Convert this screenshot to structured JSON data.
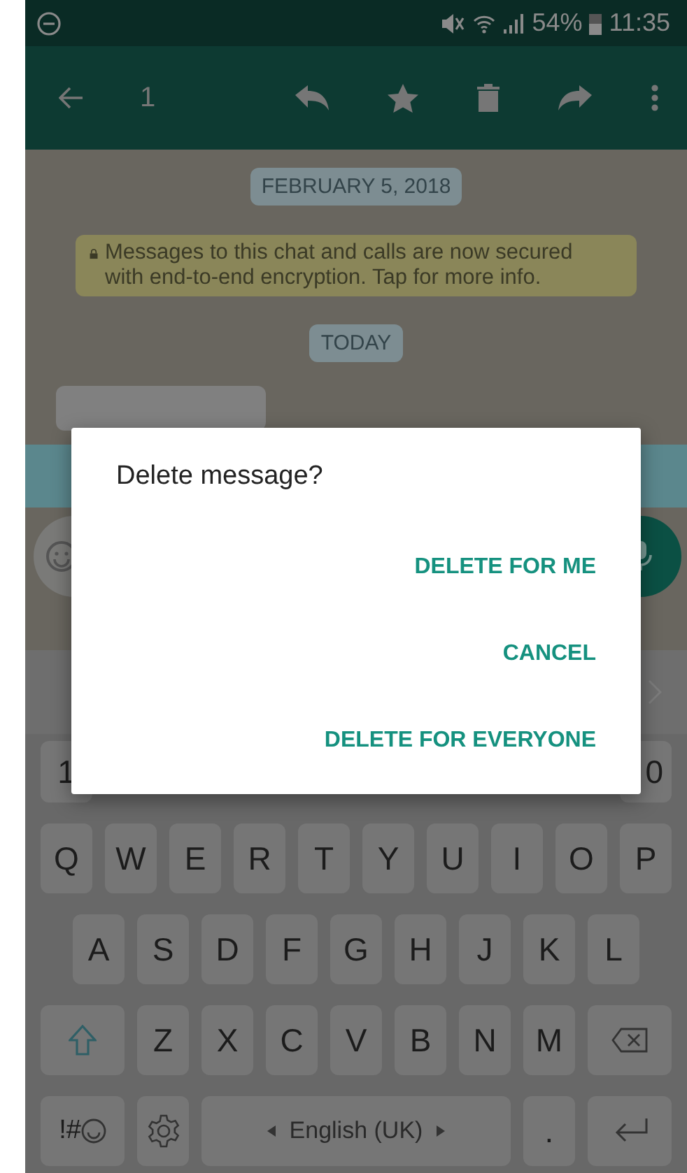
{
  "status_bar": {
    "battery": "54%",
    "time": "11:35"
  },
  "toolbar": {
    "selected_count": "1"
  },
  "chat": {
    "date_chip": "FEBRUARY 5, 2018",
    "encryption_notice": "Messages to this chat and calls are now secured with end-to-end encryption. Tap for more info.",
    "day_chip": "TODAY"
  },
  "keyboard": {
    "number_row": [
      "1",
      "0"
    ],
    "rows": [
      {
        "keys": [
          {
            "kind": "letter",
            "label": "Q"
          },
          {
            "kind": "letter",
            "label": "W"
          },
          {
            "kind": "letter",
            "label": "E"
          },
          {
            "kind": "letter",
            "label": "R"
          },
          {
            "kind": "letter",
            "label": "T"
          },
          {
            "kind": "letter",
            "label": "Y"
          },
          {
            "kind": "letter",
            "label": "U"
          },
          {
            "kind": "letter",
            "label": "I"
          },
          {
            "kind": "letter",
            "label": "O"
          },
          {
            "kind": "letter",
            "label": "P"
          }
        ]
      },
      {
        "keys": [
          {
            "kind": "letter",
            "label": "A"
          },
          {
            "kind": "letter",
            "label": "S"
          },
          {
            "kind": "letter",
            "label": "D"
          },
          {
            "kind": "letter",
            "label": "F"
          },
          {
            "kind": "letter",
            "label": "G"
          },
          {
            "kind": "letter",
            "label": "H"
          },
          {
            "kind": "letter",
            "label": "J"
          },
          {
            "kind": "letter",
            "label": "K"
          },
          {
            "kind": "letter",
            "label": "L"
          }
        ]
      },
      {
        "keys": [
          {
            "kind": "shift"
          },
          {
            "kind": "letter",
            "label": "Z"
          },
          {
            "kind": "letter",
            "label": "X"
          },
          {
            "kind": "letter",
            "label": "C"
          },
          {
            "kind": "letter",
            "label": "V"
          },
          {
            "kind": "letter",
            "label": "B"
          },
          {
            "kind": "letter",
            "label": "N"
          },
          {
            "kind": "letter",
            "label": "M"
          },
          {
            "kind": "backspace"
          }
        ]
      },
      {
        "keys": [
          {
            "kind": "symbols",
            "label": "!#"
          },
          {
            "kind": "settings"
          },
          {
            "kind": "space",
            "label": "English (UK)"
          },
          {
            "kind": "letter",
            "label": "."
          },
          {
            "kind": "enter"
          }
        ]
      }
    ]
  },
  "dialog": {
    "title": "Delete message?",
    "buttons": [
      "DELETE FOR ME",
      "CANCEL",
      "DELETE FOR EVERYONE"
    ]
  }
}
